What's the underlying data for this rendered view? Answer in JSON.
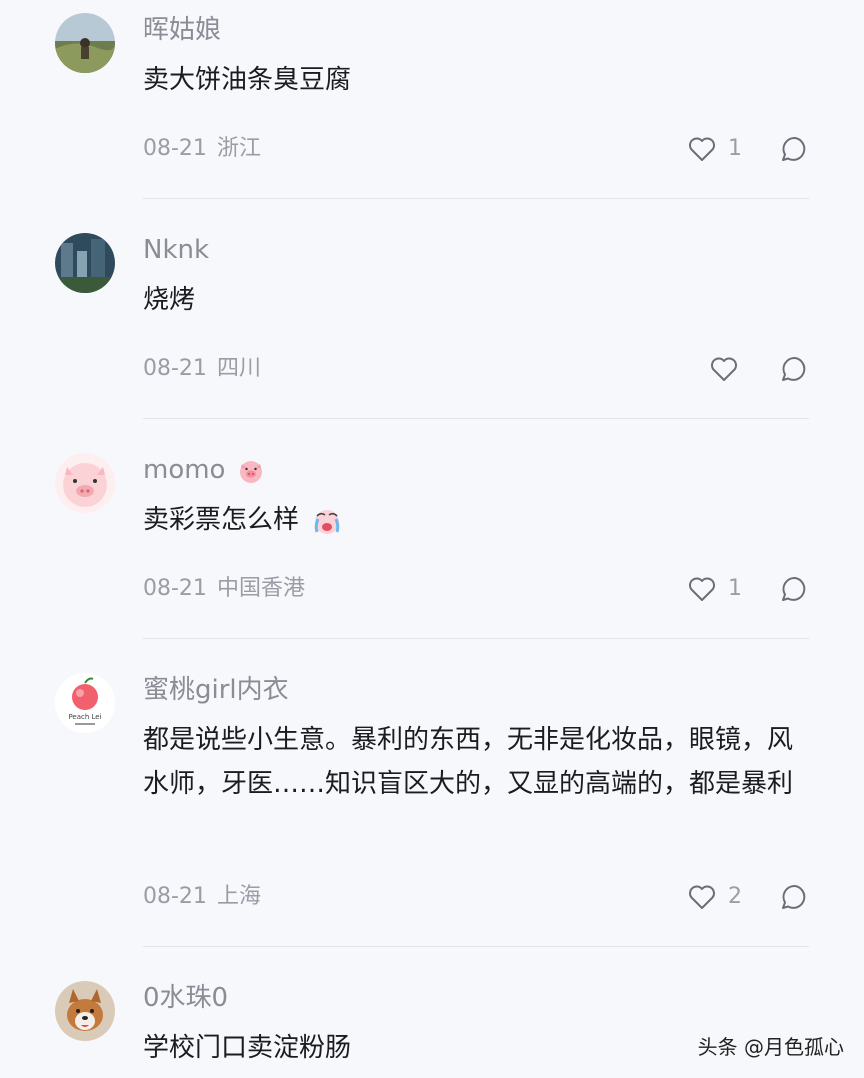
{
  "comments": [
    {
      "username": "晖姑娘",
      "text": "卖大饼油条臭豆腐",
      "date": "08-21",
      "region": "浙江",
      "likes": "1",
      "avatar": "landscape-avatar"
    },
    {
      "username": "Nknk",
      "text": "烧烤",
      "date": "08-21",
      "region": "四川",
      "likes": "",
      "avatar": "cityscape-avatar"
    },
    {
      "username": "momo",
      "text": "卖彩票怎么样",
      "date": "08-21",
      "region": "中国香港",
      "likes": "1",
      "avatar": "pig-avatar"
    },
    {
      "username": "蜜桃girl内衣",
      "text": "都是说些小生意。暴利的东西，无非是化妆品，眼镜，风水师，牙医……知识盲区大的，又显的高端的，都是暴利",
      "date": "08-21",
      "region": "上海",
      "likes": "2",
      "avatar": "peach-logo-avatar",
      "logo_text": "Peach Lei"
    },
    {
      "username": "0水珠0",
      "text": "学校门口卖淀粉肠",
      "avatar": "dog-avatar"
    }
  ],
  "watermark": "头条 @月色孤心",
  "icons": {
    "like": "heart-outline-icon",
    "reply": "speech-bubble-icon",
    "username_badge": "pig-face-emoji",
    "inline_emoji": "crying-face-emoji"
  },
  "colors": {
    "background": "#f7f8fc",
    "username": "#8a8c96",
    "text": "#1c1c1e",
    "meta": "#9a9ca6",
    "divider": "#e3e4ea"
  }
}
